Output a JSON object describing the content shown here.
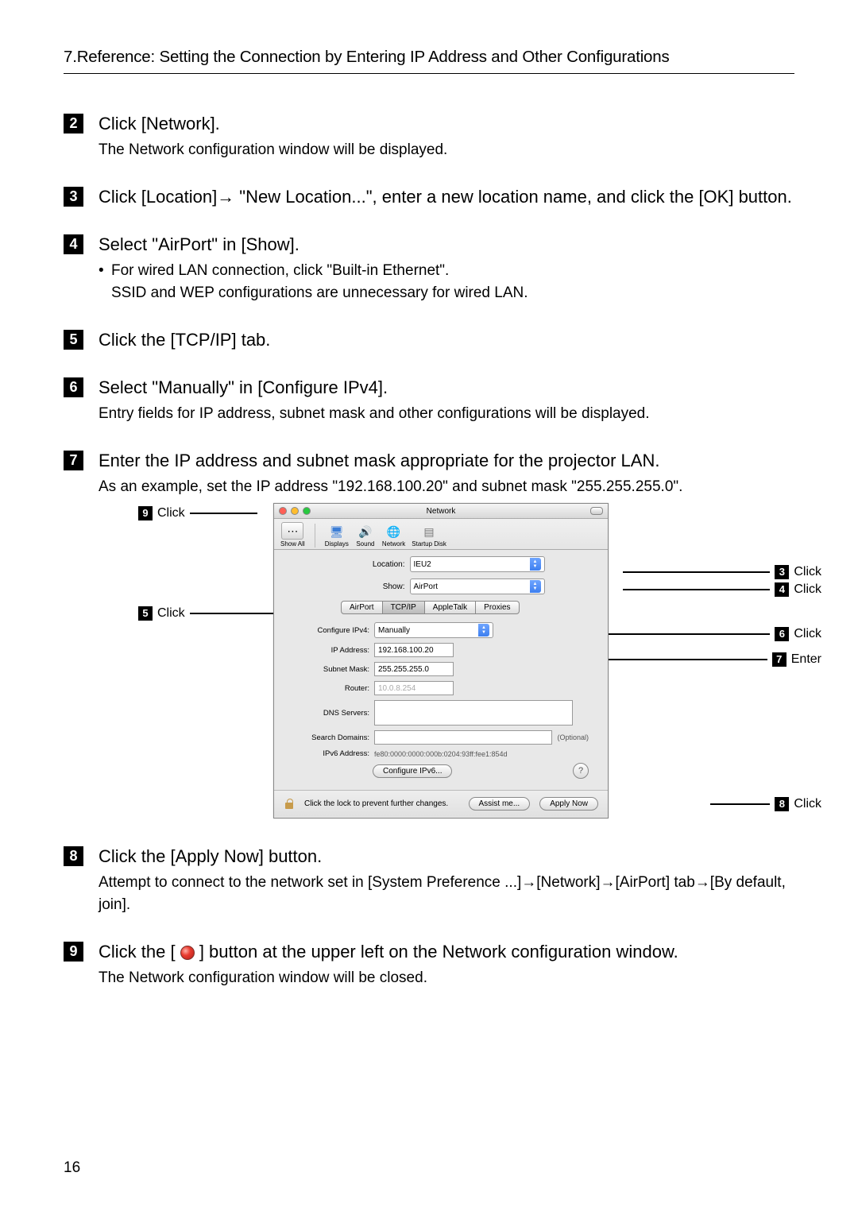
{
  "header": "7.Reference: Setting the Connection by Entering IP Address and Other Configurations",
  "page_number": "16",
  "labels": {
    "click": "Click",
    "enter": "Enter"
  },
  "steps": [
    {
      "n": "2",
      "title": "Click [Network].",
      "subs": [
        "The Network configuration window will be displayed."
      ]
    },
    {
      "n": "3",
      "title": "Click [Location]→ \"New Location...\", enter a new location name, and click the [OK] button."
    },
    {
      "n": "4",
      "title": "Select \"AirPort\" in [Show].",
      "bullets": [
        "For wired LAN connection, click \"Built-in Ethernet\".",
        "SSID and WEP configurations are unnecessary for wired LAN."
      ]
    },
    {
      "n": "5",
      "title": "Click the [TCP/IP] tab."
    },
    {
      "n": "6",
      "title": "Select \"Manually\" in [Configure IPv4].",
      "subs": [
        "Entry fields for IP address, subnet mask and other configurations will be displayed."
      ]
    },
    {
      "n": "7",
      "title": "Enter the IP address and subnet mask appropriate for the projector LAN.",
      "subs": [
        "As an example, set the IP address \"192.168.100.20\" and subnet mask \"255.255.255.0\"."
      ]
    },
    {
      "n": "8",
      "title": "Click the [Apply Now] button.",
      "subs": [
        "Attempt to connect to the network set in [System Preference ...]→[Network]→[AirPort] tab→[By default, join]."
      ]
    },
    {
      "n": "9",
      "title_parts": {
        "before": "Click the [ ",
        "after": " ] button at the upper left on the Network configuration window."
      },
      "subs": [
        "The Network configuration window will be closed."
      ]
    }
  ],
  "callouts": {
    "left_top": {
      "n": "9",
      "label": "Click"
    },
    "left_mid": {
      "n": "5",
      "label": "Click"
    },
    "r1": {
      "n": "3",
      "label": "Click"
    },
    "r2": {
      "n": "4",
      "label": "Click"
    },
    "r3": {
      "n": "6",
      "label": "Click"
    },
    "r4": {
      "n": "7",
      "label": "Enter"
    },
    "r5": {
      "n": "8",
      "label": "Click"
    }
  },
  "mac": {
    "title": "Network",
    "toolbar": {
      "show_all": "Show All",
      "displays": "Displays",
      "sound": "Sound",
      "network": "Network",
      "startup": "Startup Disk"
    },
    "location_label": "Location:",
    "location_value": "IEU2",
    "show_label": "Show:",
    "show_value": "AirPort",
    "tabs": [
      "AirPort",
      "TCP/IP",
      "AppleTalk",
      "Proxies"
    ],
    "configure_label": "Configure IPv4:",
    "configure_value": "Manually",
    "ip_label": "IP Address:",
    "ip_value": "192.168.100.20",
    "mask_label": "Subnet Mask:",
    "mask_value": "255.255.255.0",
    "router_label": "Router:",
    "router_value": "10.0.8.254",
    "dns_label": "DNS Servers:",
    "search_label": "Search Domains:",
    "optional": "(Optional)",
    "ipv6_label": "IPv6 Address:",
    "ipv6_value": "fe80:0000:0000:000b:0204:93ff:fee1:854d",
    "configure_ipv6": "Configure IPv6...",
    "lock_text": "Click the lock to prevent further changes.",
    "assist": "Assist me...",
    "apply": "Apply Now"
  }
}
